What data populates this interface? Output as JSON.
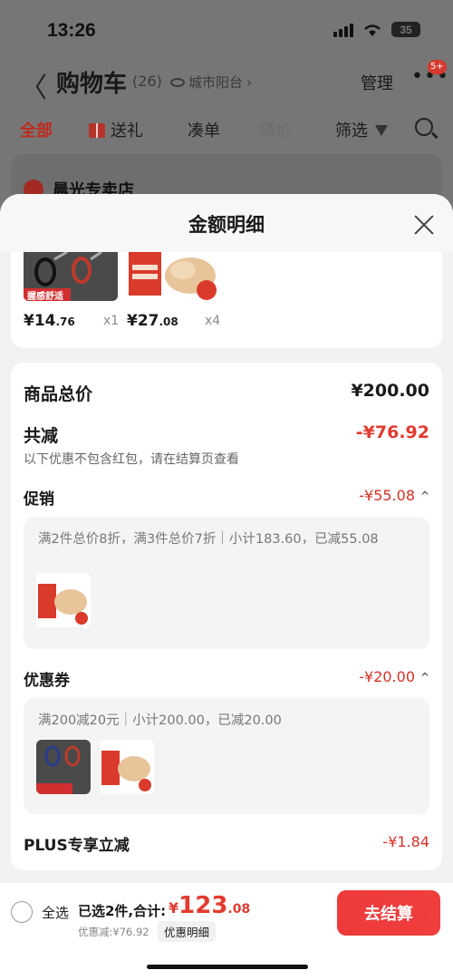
{
  "status_bar": {
    "time": "13:26",
    "battery": "35"
  },
  "nav": {
    "back": "〈",
    "title": "购物车",
    "count": "(26)",
    "location": "城市阳台",
    "manage": "管理",
    "more": "•••",
    "badge": "5+"
  },
  "tabs": [
    {
      "label": "全部"
    },
    {
      "label": "送礼"
    },
    {
      "label": "凑单"
    },
    {
      "label": "降价"
    },
    {
      "label": "筛选"
    }
  ],
  "store": {
    "name": "晨光专卖店"
  },
  "sheet": {
    "title": "金额明细",
    "products": [
      {
        "name": "scissors",
        "tag": "握感舒适",
        "price_int": "¥14",
        "price_dec": ".76",
        "qty": "x1"
      },
      {
        "name": "chicken",
        "price_int": "¥27",
        "price_dec": ".08",
        "qty": "x4"
      }
    ],
    "goods_total_label": "商品总价",
    "goods_total_value": "¥200.00",
    "total_discount_label": "共减",
    "total_discount_value": "-¥76.92",
    "note": "以下优惠不包含红包，请在结算页查看",
    "promotion": {
      "label": "促销",
      "value": "-¥55.08",
      "caret": "^",
      "text": "满2件总价8折，满3件总价7折｜小计183.60，已减55.08"
    },
    "coupon": {
      "label": "优惠券",
      "value": "-¥20.00",
      "caret": "^",
      "text": "满200减20元｜小计200.00，已减20.00"
    },
    "plus": {
      "label": "PLUS专享立减",
      "value": "-¥1.84"
    }
  },
  "bottom_bar": {
    "select_all": "全选",
    "selected_info": "已选2件,合计:",
    "total_currency": "¥",
    "total_int": "123",
    "total_dec": ".08",
    "discount_text": "优惠减:¥76.92",
    "detail_link": "优惠明细",
    "checkout": "去结算"
  },
  "colors": {
    "accent_red": "#e33b2f",
    "dim_overlay": "#767676"
  }
}
